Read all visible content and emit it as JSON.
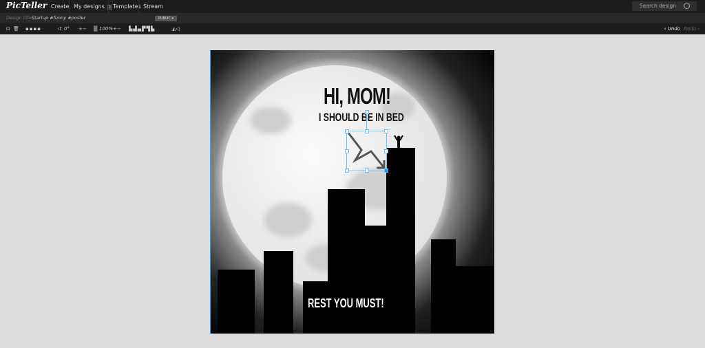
{
  "app": {
    "logo": "PicTeller"
  },
  "nav": {
    "create": "Create",
    "my_designs": "My designs",
    "my_designs_count": "0",
    "templates": "Templates",
    "stream": "Stream"
  },
  "search": {
    "placeholder": "Search design"
  },
  "title_bar": {
    "label": "Design title:",
    "value": "Startup #funny #poster",
    "visibility": "PUBLIC ▾"
  },
  "toolbar": {
    "rotation": "0°",
    "zoom": "100%",
    "undo": "‹ Undo",
    "redo": "Redo ›"
  },
  "poster": {
    "headline": "HI, MOM!",
    "subline": "I SHOULD BE IN BED",
    "footer": "REST YOU MUST!"
  }
}
